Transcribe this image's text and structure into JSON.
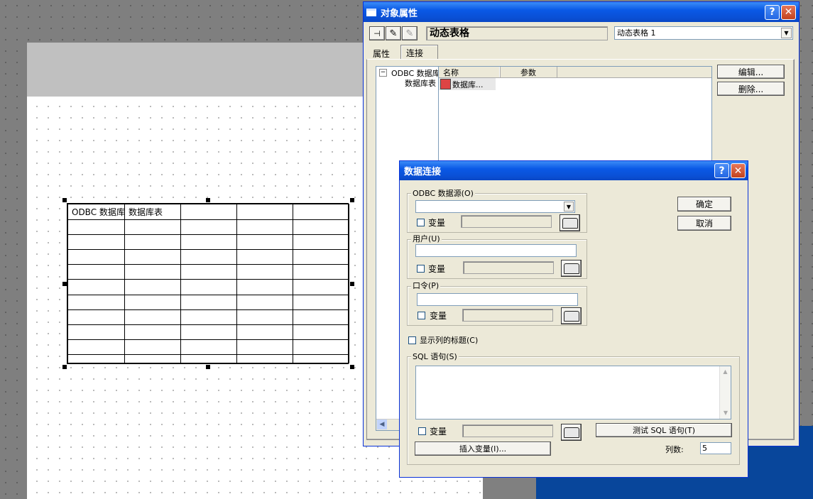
{
  "canvas_table": {
    "cell_1": "ODBC 数据库",
    "cell_2": "数据库表"
  },
  "props_window": {
    "title": "对象属性",
    "object_name": "动态表格",
    "object_select_value": "动态表格 1",
    "tabs": [
      "属性",
      "连接"
    ],
    "tree": {
      "root": "ODBC 数据库",
      "child": "数据库表"
    },
    "list_headers": [
      "名称",
      "参数"
    ],
    "list_items": [
      "数据库..."
    ],
    "edit_button": "编辑...",
    "delete_button": "删除..."
  },
  "dialog": {
    "title": "数据连接",
    "odbc_group": "ODBC 数据源(O)",
    "user_group": "用户(U)",
    "password_group": "口令(P)",
    "variable_label": "变量",
    "show_titles_label": "显示列的标题(C)",
    "sql_group": "SQL 语句(S)",
    "ok_button": "确定",
    "cancel_button": "取消",
    "test_sql_button": "测试 SQL 语句(T)",
    "insert_var_button": "插入变量(I)...",
    "columns_label": "列数:",
    "columns_value": "5"
  },
  "colors": {
    "titlebar": "#0a59e6",
    "dialog_bg": "#ece9d8",
    "desktop_blue": "#08469b"
  }
}
